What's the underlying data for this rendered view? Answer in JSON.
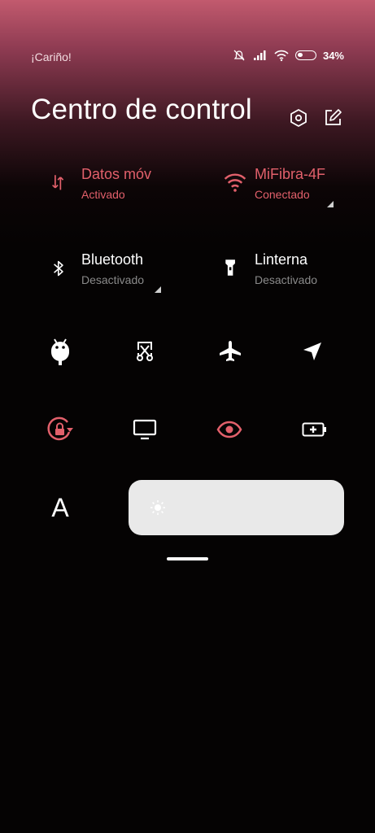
{
  "status_bar": {
    "carrier": "¡Cariño!",
    "battery_percent": 34,
    "battery_text": "34%",
    "icons": [
      "mute-bell-icon",
      "signal-icon",
      "wifi-icon",
      "battery-icon"
    ]
  },
  "header": {
    "title": "Centro de control",
    "settings_icon": "hexagon-settings-icon",
    "edit_icon": "edit-icon"
  },
  "big_tiles": [
    {
      "name": "Datos móv",
      "status": "Activado",
      "icon": "mobile-data-arrows-icon",
      "active": true
    },
    {
      "name": "MiFibra-4F",
      "status": "Conectado",
      "icon": "wifi-icon",
      "active": true
    },
    {
      "name": "Bluetooth",
      "status": "Desactivado",
      "icon": "bluetooth-icon",
      "active": false
    },
    {
      "name": "Linterna",
      "status": "Desactivado",
      "icon": "flashlight-icon",
      "active": false
    }
  ],
  "quick_toggles_row1": [
    "android-debug-icon",
    "screenshot-scissors-icon",
    "airplane-icon",
    "location-arrow-icon"
  ],
  "quick_toggles_row2": [
    "rotation-lock-icon",
    "cast-screen-icon",
    "reading-mode-eye-icon",
    "battery-saver-icon"
  ],
  "font_toggle": {
    "label": "A",
    "icon": "font-size-icon"
  },
  "brightness": {
    "icon": "sun-icon",
    "level": 0.0
  },
  "colors": {
    "accent": "#e2606b",
    "inactive_text": "#8a8a8a",
    "slider_bg": "#e9e9e9"
  }
}
